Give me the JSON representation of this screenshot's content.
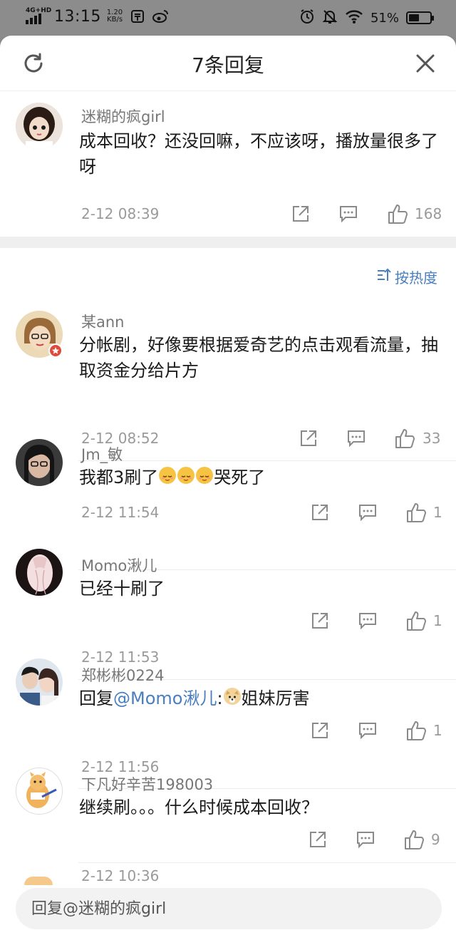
{
  "status_bar": {
    "network": "4G+HD",
    "time": "13:15",
    "speed_value": "1.20",
    "speed_unit": "KB/s",
    "battery": "51%",
    "battery_level": 0.51
  },
  "header": {
    "title": "7条回复"
  },
  "main_comment": {
    "name": "迷糊的疯girl",
    "text": "成本回收？还没回嘛，不应该呀，播放量很多了呀",
    "time": "2-12 08:39",
    "likes": "168"
  },
  "sort": {
    "label": "按热度"
  },
  "replies": [
    {
      "name": "某ann",
      "text": "分帐剧，好像要根据爱奇艺的点击观看流量，抽取资金分给片方",
      "time": "2-12 08:52",
      "likes": "33"
    },
    {
      "name": "Jm_敏",
      "text_before": "我都3刷了",
      "text_after": "哭死了",
      "time": "2-12 11:54",
      "likes": "1"
    },
    {
      "name": "Momo湫儿",
      "text": "已经十刷了",
      "time": "2-12 11:53",
      "likes": "1"
    },
    {
      "name": "郑彬彬0224",
      "reply_prefix": "回复",
      "mention": "@Momo湫儿",
      "colon": ":",
      "text_after": "姐妹厉害",
      "time": "2-12 11:56",
      "likes": "1"
    },
    {
      "name": "下凡好辛苦198003",
      "text": "继续刷。。。什么时候成本回收？",
      "time": "2-12 10:36",
      "likes": "9"
    }
  ],
  "reply_input": {
    "placeholder": "回复@迷糊的疯girl"
  },
  "colors": {
    "accent_blue": "#4a7fbf",
    "muted_gray": "#9a9a9a"
  }
}
